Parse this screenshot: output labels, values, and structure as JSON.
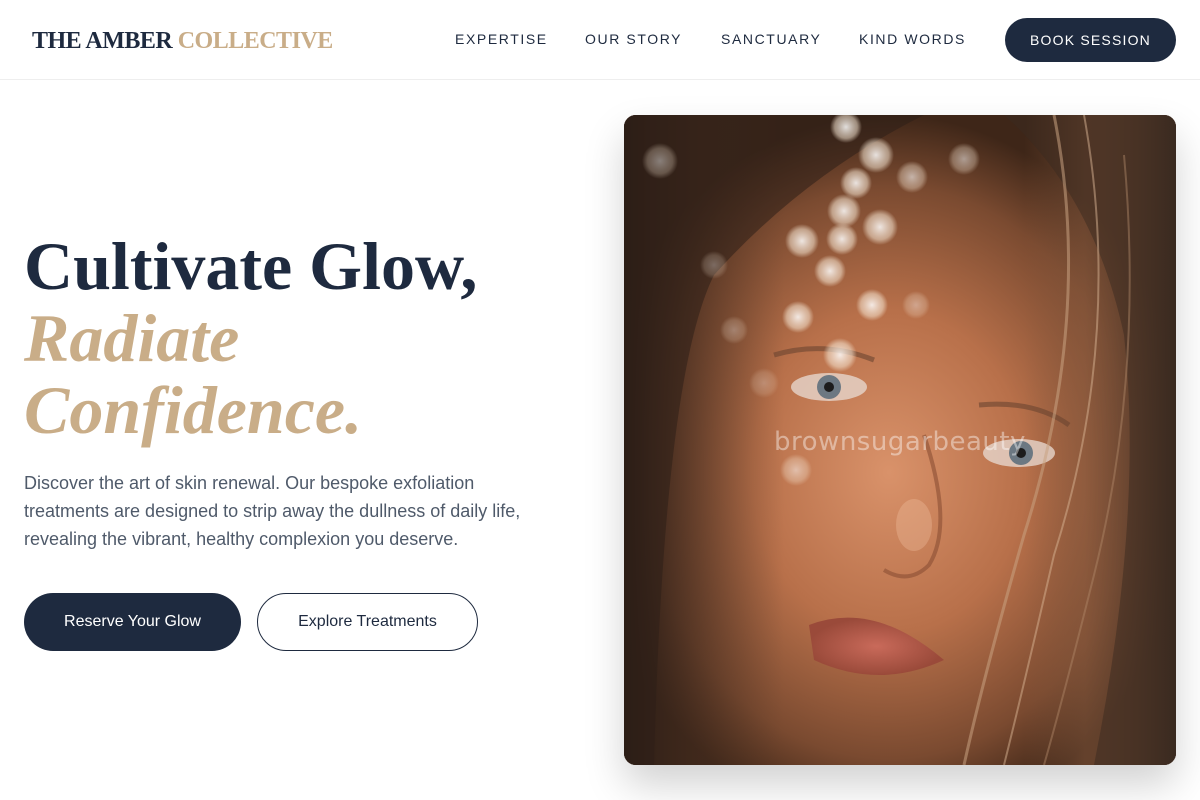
{
  "brand": {
    "name_dark": "THE AMBER",
    "name_gold": "COLLECTIVE"
  },
  "nav": {
    "items": [
      {
        "label": "EXPERTISE"
      },
      {
        "label": "OUR STORY"
      },
      {
        "label": "SANCTUARY"
      },
      {
        "label": "KIND WORDS"
      }
    ],
    "cta_label": "BOOK SESSION"
  },
  "hero": {
    "title_line1": "Cultivate Glow,",
    "title_line2": "Radiate",
    "title_line3": "Confidence.",
    "description": "Discover the art of skin renewal. Our bespoke exfoliation treatments are designed to strip away the dullness of daily life, revealing the vibrant, healthy complexion you deserve.",
    "primary_button": "Reserve Your Glow",
    "secondary_button": "Explore Treatments",
    "image_watermark": "brownsugarbeauty"
  },
  "colors": {
    "navy": "#1e2a3f",
    "gold": "#c9ad88",
    "body_text": "#4f5a6a"
  }
}
